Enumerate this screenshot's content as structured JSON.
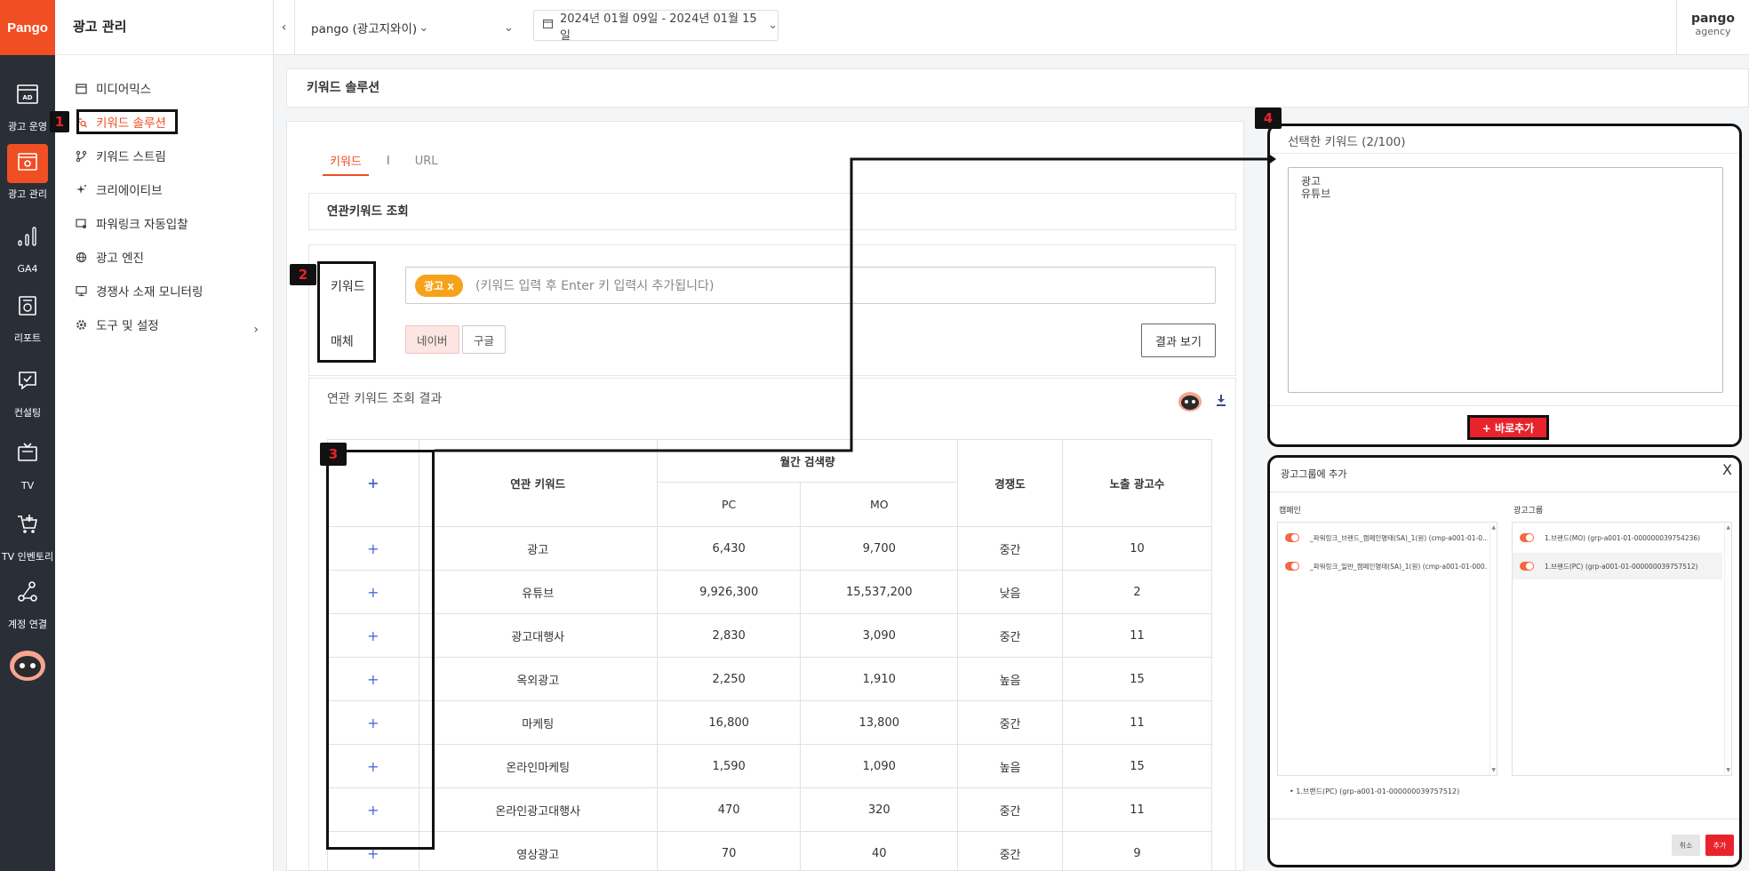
{
  "rail": {
    "logo": "Pango",
    "items": [
      {
        "label": "광고 운영",
        "icon": "ad-icon"
      },
      {
        "label": "광고 관리",
        "icon": "window-gear-icon"
      },
      {
        "label": "GA4",
        "icon": "bar-chart-icon"
      },
      {
        "label": "리포트",
        "icon": "report-icon"
      },
      {
        "label": "컨설팅",
        "icon": "consulting-icon"
      },
      {
        "label": "TV",
        "icon": "tv-icon"
      },
      {
        "label": "TV 인벤토리",
        "icon": "cart-plus-icon"
      },
      {
        "label": "계정 연결",
        "icon": "share-nodes-icon"
      }
    ]
  },
  "nav": {
    "title": "광고 관리",
    "items": [
      {
        "label": "미디어믹스",
        "icon": "calendar-icon"
      },
      {
        "label": "키워드 솔루션",
        "icon": "search-list-icon"
      },
      {
        "label": "키워드 스트림",
        "icon": "branch-icon"
      },
      {
        "label": "크리에이티브",
        "icon": "sparkle-icon"
      },
      {
        "label": "파워링크 자동입찰",
        "icon": "auto-bid-icon"
      },
      {
        "label": "광고 엔진",
        "icon": "globe-icon"
      },
      {
        "label": "경쟁사 소재 모니터링",
        "icon": "monitor-icon"
      },
      {
        "label": "도구 및 설정",
        "icon": "gear-icon"
      }
    ]
  },
  "topbar": {
    "account": "pango (광고지와이)",
    "date_range": "2024년 01월 09일 - 2024년 01월 15일",
    "brand_line1": "pango",
    "brand_line2": "agency"
  },
  "page": {
    "title": "키워드 솔루션"
  },
  "tabs": {
    "keyword": "키워드",
    "sep": "I",
    "url": "URL"
  },
  "search": {
    "section_title": "연관키워드 조회",
    "keyword_label": "키워드",
    "media_label": "매체",
    "chip": "광고 x",
    "placeholder": "(키워드 입력 후 Enter 키 입력시 추가됩니다)",
    "media_naver": "네이버",
    "media_google": "구글",
    "result_button": "결과 보기"
  },
  "results": {
    "title": "연관 키워드 조회 결과",
    "headers": {
      "plus": "+",
      "keyword": "연관 키워드",
      "monthly": "월간 검색량",
      "pc": "PC",
      "mo": "MO",
      "competition": "경쟁도",
      "ads": "노출 광고수"
    },
    "rows": [
      {
        "plus": "+",
        "keyword": "광고",
        "pc": "6,430",
        "mo": "9,700",
        "comp": "중간",
        "ads": "10"
      },
      {
        "plus": "+",
        "keyword": "유튜브",
        "pc": "9,926,300",
        "mo": "15,537,200",
        "comp": "낮음",
        "ads": "2"
      },
      {
        "plus": "+",
        "keyword": "광고대행사",
        "pc": "2,830",
        "mo": "3,090",
        "comp": "중간",
        "ads": "11"
      },
      {
        "plus": "+",
        "keyword": "옥외광고",
        "pc": "2,250",
        "mo": "1,910",
        "comp": "높음",
        "ads": "15"
      },
      {
        "plus": "+",
        "keyword": "마케팅",
        "pc": "16,800",
        "mo": "13,800",
        "comp": "중간",
        "ads": "11"
      },
      {
        "plus": "+",
        "keyword": "온라인마케팅",
        "pc": "1,590",
        "mo": "1,090",
        "comp": "높음",
        "ads": "15"
      },
      {
        "plus": "+",
        "keyword": "온라인광고대행사",
        "pc": "470",
        "mo": "320",
        "comp": "중간",
        "ads": "11"
      },
      {
        "plus": "+",
        "keyword": "영상광고",
        "pc": "70",
        "mo": "40",
        "comp": "중간",
        "ads": "9"
      }
    ]
  },
  "selected": {
    "title": "선택한 키워드 (2/100)",
    "line1": "광고",
    "line2": "유튜브",
    "add_now": "+ 바로추가"
  },
  "adgroup": {
    "title": "광고그룹에 추가",
    "close": "X",
    "campaign_label": "캠페인",
    "group_label": "광고그룹",
    "campaigns": [
      "_파워링크_브랜드_캠페인명태(SA)_1(원) (cmp-a001-01-0...",
      "_파워링크_일반_캠페인명태(SA)_1(원) (cmp-a001-01-000..."
    ],
    "groups": [
      "1.브랜드(MO) (grp-a001-01-000000039754236)",
      "1.브랜드(PC) (grp-a001-01-000000039757512)"
    ],
    "chosen": "1.브랜드(PC) (grp-a001-01-000000039757512)",
    "cancel": "취소",
    "add": "추가"
  },
  "markers": [
    "1",
    "2",
    "3",
    "4"
  ],
  "colors": {
    "accent": "#f04e23",
    "rail": "#2a2e37",
    "danger": "#e9232c",
    "chip": "#f7a21b"
  }
}
